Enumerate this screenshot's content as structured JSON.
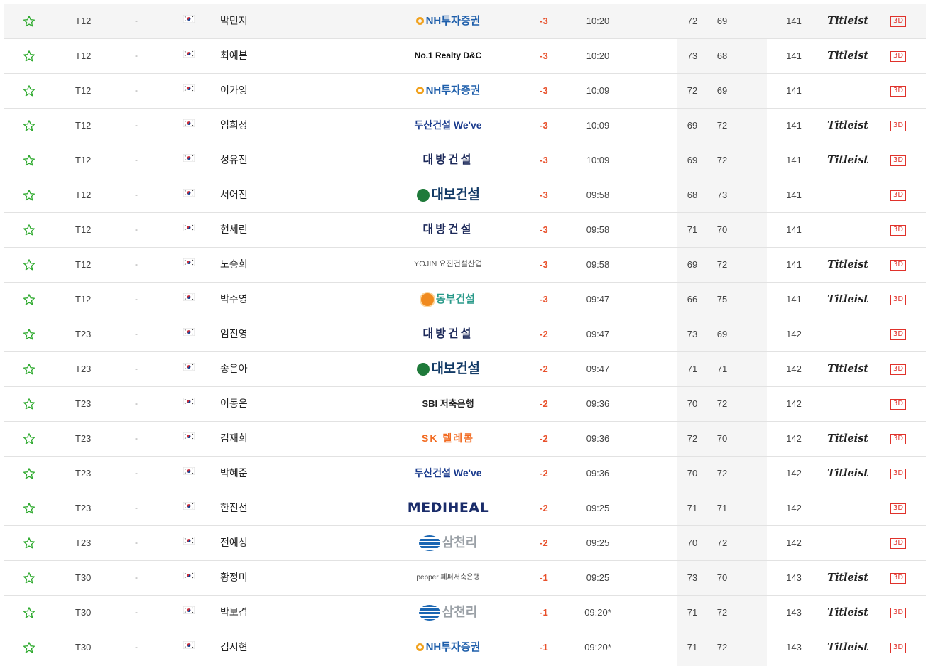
{
  "brand_colors": {
    "under_par": "#e8502b",
    "star": "#2eaa2e",
    "btn_3d": "#e0322b"
  },
  "rows": [
    {
      "rank": "T12",
      "move": "-",
      "name": "박민지",
      "sponsor": "NH투자증권",
      "sponsor_key": "nh",
      "to_par": "-3",
      "tee": "10:20",
      "r1": "72",
      "r2": "69",
      "total": "141",
      "equipment": "Titleist",
      "view3d": "3D"
    },
    {
      "rank": "T12",
      "move": "-",
      "name": "최예본",
      "sponsor": "No.1 Realty D&C",
      "sponsor_key": "no1",
      "to_par": "-3",
      "tee": "10:20",
      "r1": "73",
      "r2": "68",
      "total": "141",
      "equipment": "Titleist",
      "view3d": "3D"
    },
    {
      "rank": "T12",
      "move": "-",
      "name": "이가영",
      "sponsor": "NH투자증권",
      "sponsor_key": "nh",
      "to_par": "-3",
      "tee": "10:09",
      "r1": "72",
      "r2": "69",
      "total": "141",
      "equipment": "",
      "view3d": "3D"
    },
    {
      "rank": "T12",
      "move": "-",
      "name": "임희정",
      "sponsor": "두산건설 We've",
      "sponsor_key": "doosan",
      "to_par": "-3",
      "tee": "10:09",
      "r1": "69",
      "r2": "72",
      "total": "141",
      "equipment": "Titleist",
      "view3d": "3D"
    },
    {
      "rank": "T12",
      "move": "-",
      "name": "성유진",
      "sponsor": "대방건설",
      "sponsor_key": "daebang",
      "to_par": "-3",
      "tee": "10:09",
      "r1": "69",
      "r2": "72",
      "total": "141",
      "equipment": "Titleist",
      "view3d": "3D"
    },
    {
      "rank": "T12",
      "move": "-",
      "name": "서어진",
      "sponsor": "대보건설",
      "sponsor_key": "daebo",
      "to_par": "-3",
      "tee": "09:58",
      "r1": "68",
      "r2": "73",
      "total": "141",
      "equipment": "",
      "view3d": "3D"
    },
    {
      "rank": "T12",
      "move": "-",
      "name": "현세린",
      "sponsor": "대방건설",
      "sponsor_key": "daebang",
      "to_par": "-3",
      "tee": "09:58",
      "r1": "71",
      "r2": "70",
      "total": "141",
      "equipment": "",
      "view3d": "3D"
    },
    {
      "rank": "T12",
      "move": "-",
      "name": "노승희",
      "sponsor": "YOJIN 요진건설산업",
      "sponsor_key": "yojin",
      "to_par": "-3",
      "tee": "09:58",
      "r1": "69",
      "r2": "72",
      "total": "141",
      "equipment": "Titleist",
      "view3d": "3D"
    },
    {
      "rank": "T12",
      "move": "-",
      "name": "박주영",
      "sponsor": "동부건설",
      "sponsor_key": "dongbu",
      "to_par": "-3",
      "tee": "09:47",
      "r1": "66",
      "r2": "75",
      "total": "141",
      "equipment": "Titleist",
      "view3d": "3D"
    },
    {
      "rank": "T23",
      "move": "-",
      "name": "임진영",
      "sponsor": "대방건설",
      "sponsor_key": "daebang",
      "to_par": "-2",
      "tee": "09:47",
      "r1": "73",
      "r2": "69",
      "total": "142",
      "equipment": "",
      "view3d": "3D"
    },
    {
      "rank": "T23",
      "move": "-",
      "name": "송은아",
      "sponsor": "대보건설",
      "sponsor_key": "daebo",
      "to_par": "-2",
      "tee": "09:47",
      "r1": "71",
      "r2": "71",
      "total": "142",
      "equipment": "Titleist",
      "view3d": "3D"
    },
    {
      "rank": "T23",
      "move": "-",
      "name": "이동은",
      "sponsor": "SBI 저축은행",
      "sponsor_key": "sbi",
      "to_par": "-2",
      "tee": "09:36",
      "r1": "70",
      "r2": "72",
      "total": "142",
      "equipment": "",
      "view3d": "3D"
    },
    {
      "rank": "T23",
      "move": "-",
      "name": "김재희",
      "sponsor": "SK 텔레콤",
      "sponsor_key": "sk",
      "to_par": "-2",
      "tee": "09:36",
      "r1": "72",
      "r2": "70",
      "total": "142",
      "equipment": "Titleist",
      "view3d": "3D"
    },
    {
      "rank": "T23",
      "move": "-",
      "name": "박혜준",
      "sponsor": "두산건설 We've",
      "sponsor_key": "doosan",
      "to_par": "-2",
      "tee": "09:36",
      "r1": "70",
      "r2": "72",
      "total": "142",
      "equipment": "Titleist",
      "view3d": "3D"
    },
    {
      "rank": "T23",
      "move": "-",
      "name": "한진선",
      "sponsor": "MEDIHEAL",
      "sponsor_key": "mediheal",
      "to_par": "-2",
      "tee": "09:25",
      "r1": "71",
      "r2": "71",
      "total": "142",
      "equipment": "",
      "view3d": "3D"
    },
    {
      "rank": "T23",
      "move": "-",
      "name": "전예성",
      "sponsor": "삼천리",
      "sponsor_key": "samchully",
      "to_par": "-2",
      "tee": "09:25",
      "r1": "70",
      "r2": "72",
      "total": "142",
      "equipment": "",
      "view3d": "3D"
    },
    {
      "rank": "T30",
      "move": "-",
      "name": "황정미",
      "sponsor": "pepper 페퍼저축은행",
      "sponsor_key": "pepper",
      "to_par": "-1",
      "tee": "09:25",
      "r1": "73",
      "r2": "70",
      "total": "143",
      "equipment": "Titleist",
      "view3d": "3D"
    },
    {
      "rank": "T30",
      "move": "-",
      "name": "박보겸",
      "sponsor": "삼천리",
      "sponsor_key": "samchully",
      "to_par": "-1",
      "tee": "09:20*",
      "r1": "71",
      "r2": "72",
      "total": "143",
      "equipment": "Titleist",
      "view3d": "3D"
    },
    {
      "rank": "T30",
      "move": "-",
      "name": "김시현",
      "sponsor": "NH투자증권",
      "sponsor_key": "nh",
      "to_par": "-1",
      "tee": "09:20*",
      "r1": "71",
      "r2": "72",
      "total": "143",
      "equipment": "Titleist",
      "view3d": "3D"
    }
  ]
}
